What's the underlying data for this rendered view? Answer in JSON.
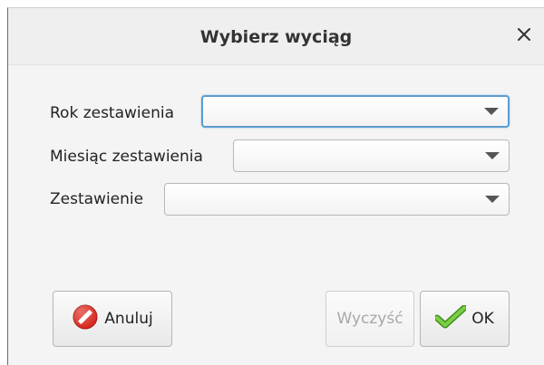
{
  "dialog": {
    "title": "Wybierz wyciąg",
    "close_icon": "close-icon"
  },
  "fields": [
    {
      "label": "Rok zestawienia",
      "value": ""
    },
    {
      "label": "Miesiąc zestawienia",
      "value": ""
    },
    {
      "label": "Zestawienie",
      "value": ""
    }
  ],
  "buttons": {
    "cancel": {
      "label": "Anuluj",
      "icon": "cancel-icon"
    },
    "clear": {
      "label": "Wyczyść",
      "enabled": false
    },
    "ok": {
      "label": "OK",
      "icon": "checkmark-icon"
    }
  },
  "colors": {
    "focus_border": "#5c9ccf",
    "cancel_icon": "#d9261c",
    "ok_icon": "#5cb531"
  }
}
